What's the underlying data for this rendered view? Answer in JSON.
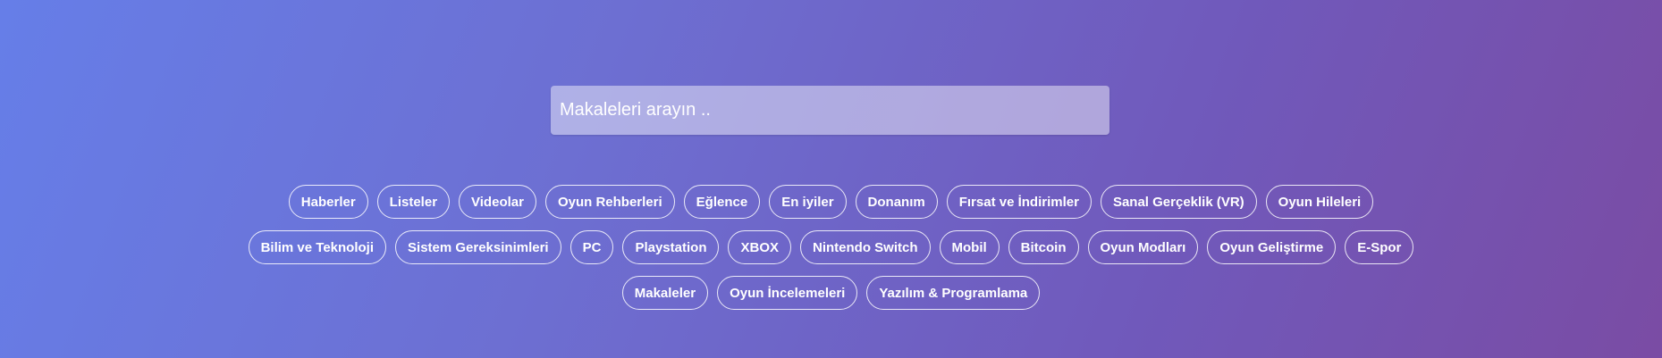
{
  "search": {
    "placeholder": "Makaleleri arayın .."
  },
  "tags": {
    "rows": [
      [
        "Haberler",
        "Listeler",
        "Videolar",
        "Oyun Rehberleri",
        "Eğlence",
        "En iyiler",
        "Donanım",
        "Fırsat ve İndirimler",
        "Sanal Gerçeklik (VR)",
        "Oyun Hileleri"
      ],
      [
        "Bilim ve Teknoloji",
        "Sistem Gereksinimleri",
        "PC",
        "Playstation",
        "XBOX",
        "Nintendo Switch",
        "Mobil",
        "Bitcoin",
        "Oyun Modları",
        "Oyun Geliştirme",
        "E-Spor"
      ],
      [
        "Makaleler",
        "Oyun İncelemeleri",
        "Yazılım & Programlama"
      ]
    ]
  },
  "colors": {
    "gradient_start": "#667ee8",
    "gradient_end": "#7a4ca4",
    "tag_border": "#ffffff",
    "text": "#ffffff"
  }
}
